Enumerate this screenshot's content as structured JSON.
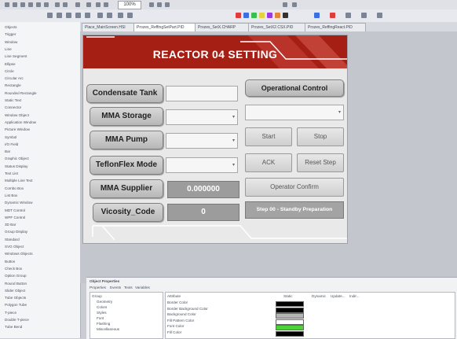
{
  "window": {
    "zoom": "100%"
  },
  "tabs": [
    "Place_MainScreen.HSI",
    "Prozes_ReffingSetPart.PID",
    "Prozes_SetX.CHARP",
    "Prozes_SetX2.CSX.PID",
    "Prozes_ReffingReact.PID"
  ],
  "object_tree": {
    "items": [
      "Objects",
      "Trigger",
      "Window",
      "Line",
      "Line Segment",
      "Ellipse",
      "Circle",
      "Circular Arc",
      "Rectangle",
      "Rounded Rectangle",
      "Static Text",
      "Connector",
      "Window Object",
      "Application Window",
      "Picture Window",
      "Symbol",
      "I/O Field",
      "Bar",
      "Graphic Object",
      "Status Display",
      "Text List",
      "Multiple Line Text",
      "Combo Box",
      "List Box",
      "Dynamic Window",
      "MDT Control",
      "WPF Control",
      "3D Bar",
      "Group Display",
      "Standard",
      "SVG Object",
      "Windows Objects",
      "Button",
      "Check Box",
      "Option Group",
      "Round Button",
      "Slider Object",
      "Tube Objects",
      "Polygon Tube",
      "T-piece",
      "Double T-piece",
      "Tube Bend"
    ]
  },
  "reactor_panel": {
    "title": "REACTOR 04 SETTING",
    "labels": {
      "condensate_tank": "Condensate Tank",
      "mma_storage": "MMA Storage",
      "mma_pump": "MMA Pump",
      "teflon_mode": "TeflonFlex Mode",
      "mma_supplier": "MMA Supplier",
      "viscosity_code": "Vicosity_Code"
    },
    "values": {
      "mma_supplier": "0.000000",
      "viscosity_code": "0"
    },
    "controls": {
      "operational_control": "Operational Control",
      "start": "Start",
      "stop": "Stop",
      "ack": "ACK",
      "reset_step": "Reset Step",
      "operator_confirm": "Operator Confirm",
      "step_status": "Step 00 - Standby Preparation"
    }
  },
  "properties": {
    "title": "Object Properties",
    "tabs": [
      "Properties",
      "Events",
      "Texts",
      "Variables"
    ],
    "groups": [
      "Group",
      "Geometry",
      "Colors",
      "Styles",
      "Font",
      "Flashing",
      "Miscellaneous"
    ],
    "header_attribute": "Attribute",
    "header_static": "Static",
    "header_dynamic": "Dynamic",
    "header_updatec": "Update...",
    "header_indirect": "Indir...",
    "attributes": [
      {
        "name": "Border Color",
        "color": "#000000"
      },
      {
        "name": "Border Background Color",
        "color": "#000000"
      },
      {
        "name": "Background Color",
        "color": "#b4b4b4"
      },
      {
        "name": "Fill Pattern Color",
        "color": "#ffffff"
      },
      {
        "name": "Font Color",
        "color": "#4fd13a"
      },
      {
        "name": "Fill Color",
        "color": "#000000"
      }
    ]
  },
  "colors": {
    "header_red": "#a51f14",
    "accent_green": "#4fd13a"
  }
}
